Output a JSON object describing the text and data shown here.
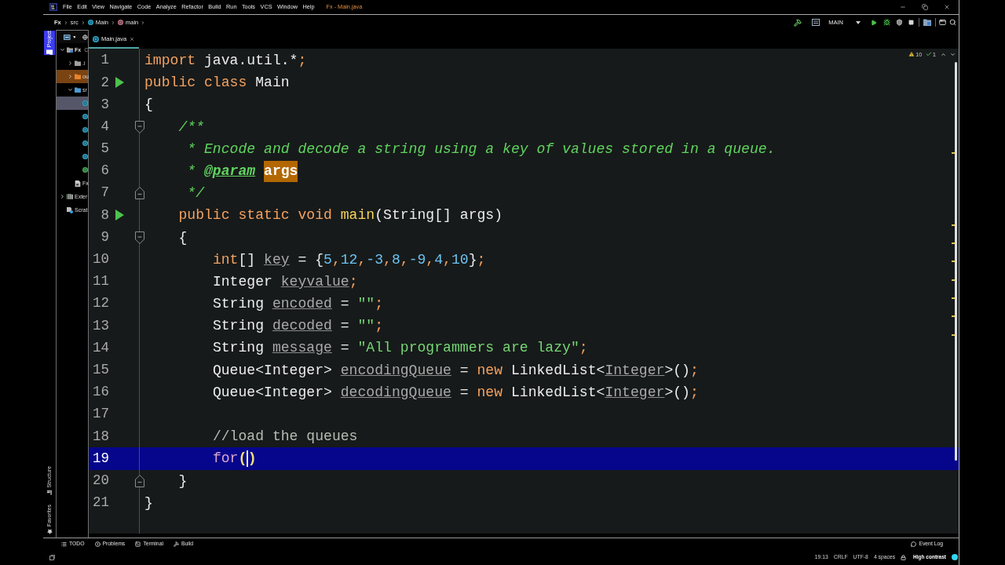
{
  "title_bar": {
    "menu": [
      "File",
      "Edit",
      "View",
      "Navigate",
      "Code",
      "Analyze",
      "Refactor",
      "Build",
      "Run",
      "Tools",
      "VCS",
      "Window",
      "Help"
    ],
    "title": "Fx - Main.java"
  },
  "nav_bar": {
    "breadcrumbs": [
      {
        "label": "Fx",
        "kind": "project"
      },
      {
        "label": "src",
        "kind": "folder"
      },
      {
        "label": "Main",
        "kind": "class"
      },
      {
        "label": "main",
        "kind": "method"
      }
    ],
    "run_config": "MAIN"
  },
  "tool_strip": [
    {
      "label": "Project",
      "kind": "project",
      "selected": true
    },
    {
      "label": "Structure",
      "kind": "structure",
      "selected": false
    },
    {
      "label": "Favorites",
      "kind": "favorites",
      "selected": false
    }
  ],
  "project_tree": [
    {
      "label": "Fx",
      "detail": "C",
      "kind": "module",
      "expanded": true,
      "selected": false,
      "children": [
        {
          "label": ".i",
          "kind": "folder",
          "expanded": false,
          "selected": false
        },
        {
          "label": "ou",
          "kind": "excluded",
          "expanded": false,
          "selected": false
        },
        {
          "label": "sr",
          "kind": "source",
          "expanded": true,
          "selected": false,
          "children": [
            {
              "kind": "class",
              "selected": true
            },
            {
              "kind": "class",
              "selected": false
            },
            {
              "kind": "class",
              "selected": false
            },
            {
              "kind": "class",
              "selected": false
            },
            {
              "kind": "class",
              "selected": false
            },
            {
              "kind": "script",
              "selected": false
            }
          ]
        },
        {
          "label": "Fx",
          "kind": "module_file",
          "selected": false
        }
      ]
    },
    {
      "label": "Exter",
      "kind": "libraries",
      "expanded": false,
      "selected": false
    },
    {
      "label": "Scrat",
      "kind": "scratches",
      "selected": false
    }
  ],
  "editor": {
    "tab": {
      "label": "Main.java",
      "selected": true
    },
    "inspections": {
      "warnings": "10",
      "passed": "1"
    },
    "lines": [
      {
        "number": "1",
        "kind": "code",
        "current": false,
        "tokens": [
          {
            "kind": "keyword",
            "text": "import"
          },
          {
            "kind": "plain",
            "text": " java.util.*"
          },
          {
            "kind": "punct",
            "text": ";"
          }
        ]
      },
      {
        "number": "2",
        "kind": "run",
        "current": false,
        "tokens": [
          {
            "kind": "keyword",
            "text": "public "
          },
          {
            "kind": "keyword",
            "text": "class"
          },
          {
            "kind": "plain",
            "text": " Main"
          }
        ]
      },
      {
        "number": "3",
        "kind": "code",
        "current": false,
        "tokens": [
          {
            "kind": "plain",
            "text": "{"
          }
        ]
      },
      {
        "number": "4",
        "kind": "fold_start",
        "current": false,
        "tokens": [
          {
            "kind": "doc",
            "text": "    /**"
          }
        ]
      },
      {
        "number": "5",
        "kind": "code",
        "current": false,
        "tokens": [
          {
            "kind": "doc",
            "text": "     * Encode and decode a string using a key of values stored in a queue."
          }
        ]
      },
      {
        "number": "6",
        "kind": "code",
        "current": false,
        "tokens": [
          {
            "kind": "doc",
            "text": "     * "
          },
          {
            "kind": "doc_tag",
            "text": "@param "
          },
          {
            "kind": "param",
            "text": "args"
          }
        ]
      },
      {
        "number": "7",
        "kind": "fold_end",
        "current": false,
        "tokens": [
          {
            "kind": "doc",
            "text": "     */"
          }
        ]
      },
      {
        "number": "8",
        "kind": "run",
        "current": false,
        "tokens": [
          {
            "kind": "keyword",
            "text": "    public "
          },
          {
            "kind": "keyword",
            "text": "static "
          },
          {
            "kind": "keyword",
            "text": "void "
          },
          {
            "kind": "method",
            "text": "main"
          },
          {
            "kind": "plain",
            "text": "(String[] args)"
          }
        ]
      },
      {
        "number": "9",
        "kind": "fold_start",
        "current": false,
        "tokens": [
          {
            "kind": "plain",
            "text": "    {"
          }
        ]
      },
      {
        "number": "10",
        "kind": "code",
        "current": false,
        "tokens": [
          {
            "kind": "keyword",
            "text": "        int"
          },
          {
            "kind": "plain",
            "text": "[] "
          },
          {
            "kind": "unused",
            "text": "key"
          },
          {
            "kind": "plain",
            "text": " = {"
          },
          {
            "kind": "number",
            "text": "5"
          },
          {
            "kind": "punct",
            "text": ","
          },
          {
            "kind": "number",
            "text": "12"
          },
          {
            "kind": "punct",
            "text": ","
          },
          {
            "kind": "number",
            "text": "-3"
          },
          {
            "kind": "punct",
            "text": ","
          },
          {
            "kind": "number",
            "text": "8"
          },
          {
            "kind": "punct",
            "text": ","
          },
          {
            "kind": "number",
            "text": "-9"
          },
          {
            "kind": "punct",
            "text": ","
          },
          {
            "kind": "number",
            "text": "4"
          },
          {
            "kind": "punct",
            "text": ","
          },
          {
            "kind": "number",
            "text": "10"
          },
          {
            "kind": "plain",
            "text": "}"
          },
          {
            "kind": "punct",
            "text": ";"
          }
        ]
      },
      {
        "number": "11",
        "kind": "code",
        "current": false,
        "tokens": [
          {
            "kind": "plain",
            "text": "        Integer "
          },
          {
            "kind": "unused",
            "text": "keyvalue"
          },
          {
            "kind": "punct",
            "text": ";"
          }
        ]
      },
      {
        "number": "12",
        "kind": "code",
        "current": false,
        "tokens": [
          {
            "kind": "plain",
            "text": "        String "
          },
          {
            "kind": "unused",
            "text": "encoded"
          },
          {
            "kind": "plain",
            "text": " = "
          },
          {
            "kind": "string",
            "text": "\"\""
          },
          {
            "kind": "punct",
            "text": ";"
          }
        ]
      },
      {
        "number": "13",
        "kind": "code",
        "current": false,
        "tokens": [
          {
            "kind": "plain",
            "text": "        String "
          },
          {
            "kind": "unused",
            "text": "decoded"
          },
          {
            "kind": "plain",
            "text": " = "
          },
          {
            "kind": "string",
            "text": "\"\""
          },
          {
            "kind": "punct",
            "text": ";"
          }
        ]
      },
      {
        "number": "14",
        "kind": "code",
        "current": false,
        "tokens": [
          {
            "kind": "plain",
            "text": "        String "
          },
          {
            "kind": "unused",
            "text": "message"
          },
          {
            "kind": "plain",
            "text": " = "
          },
          {
            "kind": "string",
            "text": "\"All programmers are lazy\""
          },
          {
            "kind": "punct",
            "text": ";"
          }
        ]
      },
      {
        "number": "15",
        "kind": "code",
        "current": false,
        "tokens": [
          {
            "kind": "plain",
            "text": "        Queue<Integer> "
          },
          {
            "kind": "unused",
            "text": "encodingQueue"
          },
          {
            "kind": "plain",
            "text": " = "
          },
          {
            "kind": "keyword",
            "text": "new"
          },
          {
            "kind": "plain",
            "text": " LinkedList<"
          },
          {
            "kind": "unused",
            "text": "Integer"
          },
          {
            "kind": "plain",
            "text": ">()"
          },
          {
            "kind": "punct",
            "text": ";"
          }
        ]
      },
      {
        "number": "16",
        "kind": "code",
        "current": false,
        "tokens": [
          {
            "kind": "plain",
            "text": "        Queue<Integer> "
          },
          {
            "kind": "unused",
            "text": "decodingQueue"
          },
          {
            "kind": "plain",
            "text": " = "
          },
          {
            "kind": "keyword",
            "text": "new"
          },
          {
            "kind": "plain",
            "text": " LinkedList<"
          },
          {
            "kind": "unused",
            "text": "Integer"
          },
          {
            "kind": "plain",
            "text": ">()"
          },
          {
            "kind": "punct",
            "text": ";"
          }
        ]
      },
      {
        "number": "17",
        "kind": "code",
        "current": false
      },
      {
        "number": "18",
        "kind": "code",
        "current": false,
        "tokens": [
          {
            "kind": "comment",
            "text": "        //load the queues"
          }
        ]
      },
      {
        "number": "19",
        "kind": "code",
        "current": true,
        "tokens": [
          {
            "kind": "keyword",
            "text": "        for"
          },
          {
            "kind": "brace_match",
            "text": "("
          },
          {
            "kind": "caret"
          },
          {
            "kind": "brace_match",
            "text": ")"
          }
        ]
      },
      {
        "number": "20",
        "kind": "fold_end",
        "current": false,
        "tokens": [
          {
            "kind": "plain",
            "text": "    }"
          }
        ]
      },
      {
        "number": "21",
        "kind": "code",
        "current": false,
        "tokens": [
          {
            "kind": "plain",
            "text": "}"
          }
        ]
      }
    ]
  },
  "tool_windows": {
    "left": [
      {
        "label": "TODO",
        "kind": "todo"
      },
      {
        "label": "Problems",
        "kind": "problems"
      },
      {
        "label": "Terminal",
        "kind": "terminal"
      },
      {
        "label": "Build",
        "kind": "build"
      }
    ],
    "right": [
      {
        "label": "Event Log",
        "kind": "event_log"
      }
    ]
  },
  "status_bar": {
    "items": [
      "19:13",
      "CRLF",
      "UTF-8",
      "4 spaces"
    ],
    "theme": "High contrast"
  }
}
